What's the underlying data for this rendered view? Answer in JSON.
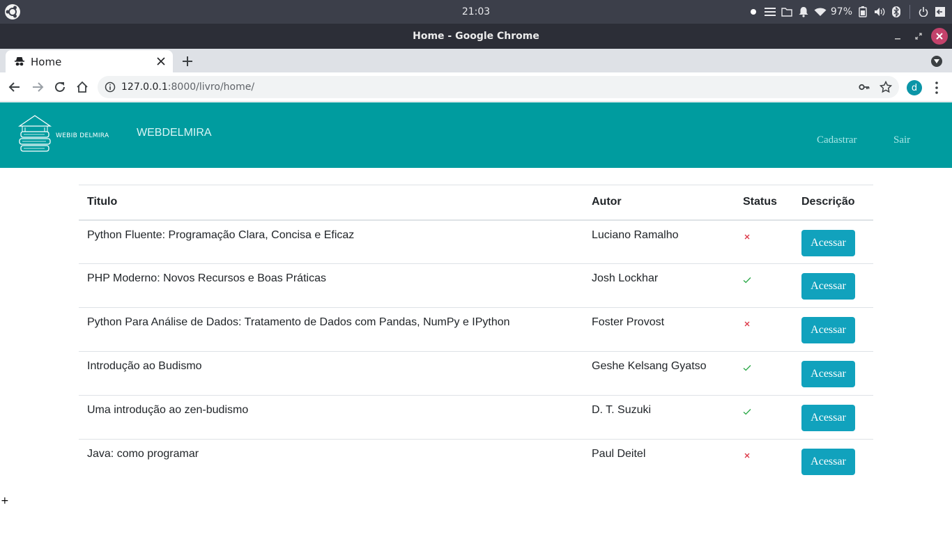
{
  "os": {
    "clock": "21:03",
    "battery": "97%",
    "icons": [
      "ubuntu-logo-icon",
      "dot-icon",
      "menu-icon",
      "folder-icon",
      "bell-icon",
      "wifi-icon",
      "battery-icon",
      "volume-icon",
      "bluetooth-icon",
      "power-icon",
      "exit-icon"
    ]
  },
  "window": {
    "title": "Home - Google Chrome"
  },
  "tabs": [
    {
      "label": "Home",
      "icon": "incognito-icon",
      "active": true
    }
  ],
  "toolbar": {
    "url_host": "127.0.0.1",
    "url_rest": ":8000/livro/home/",
    "profile_initial": "d"
  },
  "site": {
    "logo_text": "WEBIB DELMIRA",
    "brand": "WEBDELMIRA",
    "nav": [
      {
        "label": "Cadastrar"
      },
      {
        "label": "Sair"
      }
    ],
    "header_color": "#009c9f"
  },
  "table": {
    "headers": [
      "Titulo",
      "Autor",
      "Status",
      "Descrição"
    ],
    "rows": [
      {
        "title": "Python Fluente: Programação Clara, Concisa e Eficaz",
        "author": "Luciano Ramalho",
        "status": "unavailable",
        "action": "Acessar"
      },
      {
        "title": "PHP Moderno: Novos Recursos e Boas Práticas",
        "author": "Josh Lockhar",
        "status": "available",
        "action": "Acessar"
      },
      {
        "title": "Python Para Análise de Dados: Tratamento de Dados com Pandas, NumPy e IPython",
        "author": "Foster Provost",
        "status": "unavailable",
        "action": "Acessar"
      },
      {
        "title": "Introdução ao Budismo",
        "author": "Geshe Kelsang Gyatso",
        "status": "available",
        "action": "Acessar"
      },
      {
        "title": "Uma introdução ao zen-budismo",
        "author": "D. T. Suzuki",
        "status": "available",
        "action": "Acessar"
      },
      {
        "title": "Java: como programar",
        "author": "Paul Deitel",
        "status": "unavailable",
        "action": "Acessar"
      }
    ]
  },
  "colors": {
    "available": "#28a745",
    "unavailable": "#dc3545",
    "button": "#11a2bd"
  }
}
